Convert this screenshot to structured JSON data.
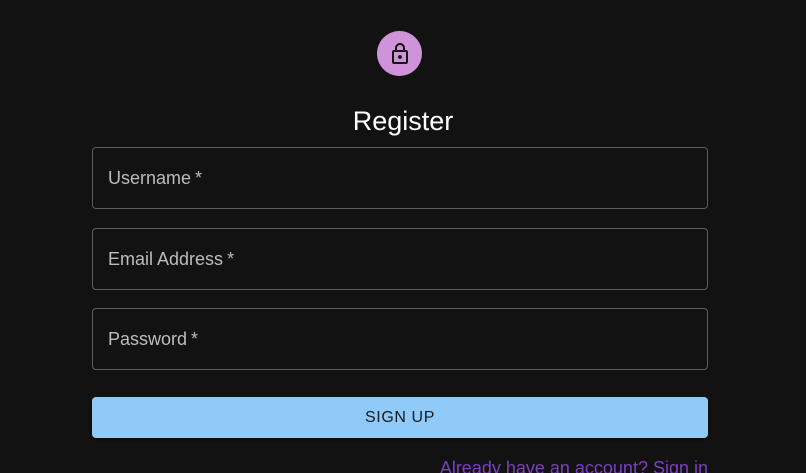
{
  "header": {
    "icon": "lock-icon",
    "title": "Register"
  },
  "form": {
    "fields": [
      {
        "label": "Username",
        "required_marker": "*",
        "value": ""
      },
      {
        "label": "Email Address",
        "required_marker": "*",
        "value": ""
      },
      {
        "label": "Password",
        "required_marker": "*",
        "value": ""
      }
    ],
    "submit_label": "SIGN UP",
    "signin_link": "Already have an account? Sign in"
  },
  "colors": {
    "background": "#121212",
    "avatar": "#ce93d8",
    "primary_button": "#90caf9",
    "link": "#7b3fbf"
  }
}
